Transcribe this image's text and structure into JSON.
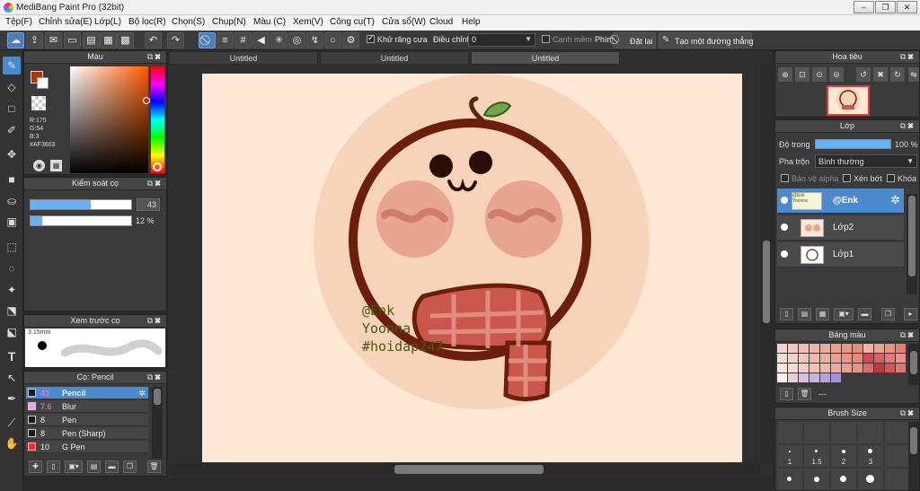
{
  "window": {
    "title": "MediBang Paint Pro (32bit)"
  },
  "menu": [
    "Tệp(F)",
    "Chỉnh sửa(E)",
    "Lớp(L)",
    "Bộ lọc(R)",
    "Chọn(S)",
    "Chụp(N)",
    "Màu (C)",
    "Xem(V)",
    "Công cụ(T)",
    "Cửa sổ(W)",
    "Cloud",
    "Help"
  ],
  "toolbar": {
    "antialias_label": "Khử răng cưa",
    "adjust_label": "Điều chỉnh",
    "adjust_value": "0",
    "edge_label": "Cạnh mềm",
    "key_label": "Phím",
    "reset_label": "Đặt lại",
    "straight_label": "Tạo một đường thẳng"
  },
  "tabs": [
    "Untitled",
    "Untitled",
    "Untitled"
  ],
  "color_panel": {
    "title": "Màu",
    "fg_color": "#AF3603",
    "r": "R:175",
    "g": "G:54",
    "b": "B:3",
    "hex": "#AF3603"
  },
  "brush_control": {
    "title": "Kiểm soát cọ",
    "size_value": "43",
    "size_fraction": 0.6,
    "opacity_value": "12 %",
    "opacity_fraction": 0.12
  },
  "brush_preview": {
    "title": "Xem trước cọ",
    "size_label": "3.15mm"
  },
  "brush_list": {
    "title": "Cọ: Pencil",
    "items": [
      {
        "size": "43",
        "name": "Pencil",
        "color": "#1a1a1a"
      },
      {
        "size": "7.6",
        "name": "Blur",
        "color": "#ff9cf0"
      },
      {
        "size": "8",
        "name": "Pen",
        "color": "#1a1a1a"
      },
      {
        "size": "8",
        "name": "Pen (Sharp)",
        "color": "#1a1a1a"
      },
      {
        "size": "10",
        "name": "G Pen",
        "color": "#ff2a2a"
      }
    ]
  },
  "navigator": {
    "title": "Hoa tiêu"
  },
  "layers": {
    "title": "Lớp",
    "opacity_label": "Độ trong",
    "opacity_value": "100 %",
    "blend_label": "Pha trộn",
    "blend_value": "Bình thường",
    "protect_alpha": "Bảo vệ alpha",
    "clip": "Xén bớt",
    "lock": "Khóa",
    "items": [
      {
        "name": "@Enk"
      },
      {
        "name": "Lớp2"
      },
      {
        "name": "Lớp1"
      }
    ]
  },
  "palette": {
    "title": "Bảng màu",
    "selected_label": "---",
    "colors": [
      "#f6d2c8",
      "#f4c8bc",
      "#f2beb0",
      "#f0b4a4",
      "#eeaa98",
      "#eca08c",
      "#ea9680",
      "#e88c74",
      "#f4b0a0",
      "#f0a090",
      "#ec9080",
      "#e88070",
      "#f8dcd4",
      "#f6d0c6",
      "#f4c4b8",
      "#f2b8aa",
      "#f0ac9c",
      "#eea08e",
      "#ec9480",
      "#ea8872",
      "#d84848",
      "#e06060",
      "#e87878",
      "#f09090",
      "#fae6e0",
      "#f8dad2",
      "#f6cec4",
      "#f4c2b6",
      "#f2b6a8",
      "#f0aa9a",
      "#ee9e8c",
      "#ec927e",
      "#e06a6a",
      "#d83030",
      "#e05050",
      "#e87070",
      "#fcf0ec",
      "#e8d0e0",
      "#d8c0e0",
      "#c8b0e0",
      "#b8a0e0",
      "#a890e0"
    ]
  },
  "brush_size": {
    "title": "Brush Size",
    "labels": [
      "1",
      "1.5",
      "2",
      "3"
    ]
  },
  "artwork": {
    "line1": "@Enk",
    "line2": "Yoonna",
    "line3": "#hoidap247"
  }
}
